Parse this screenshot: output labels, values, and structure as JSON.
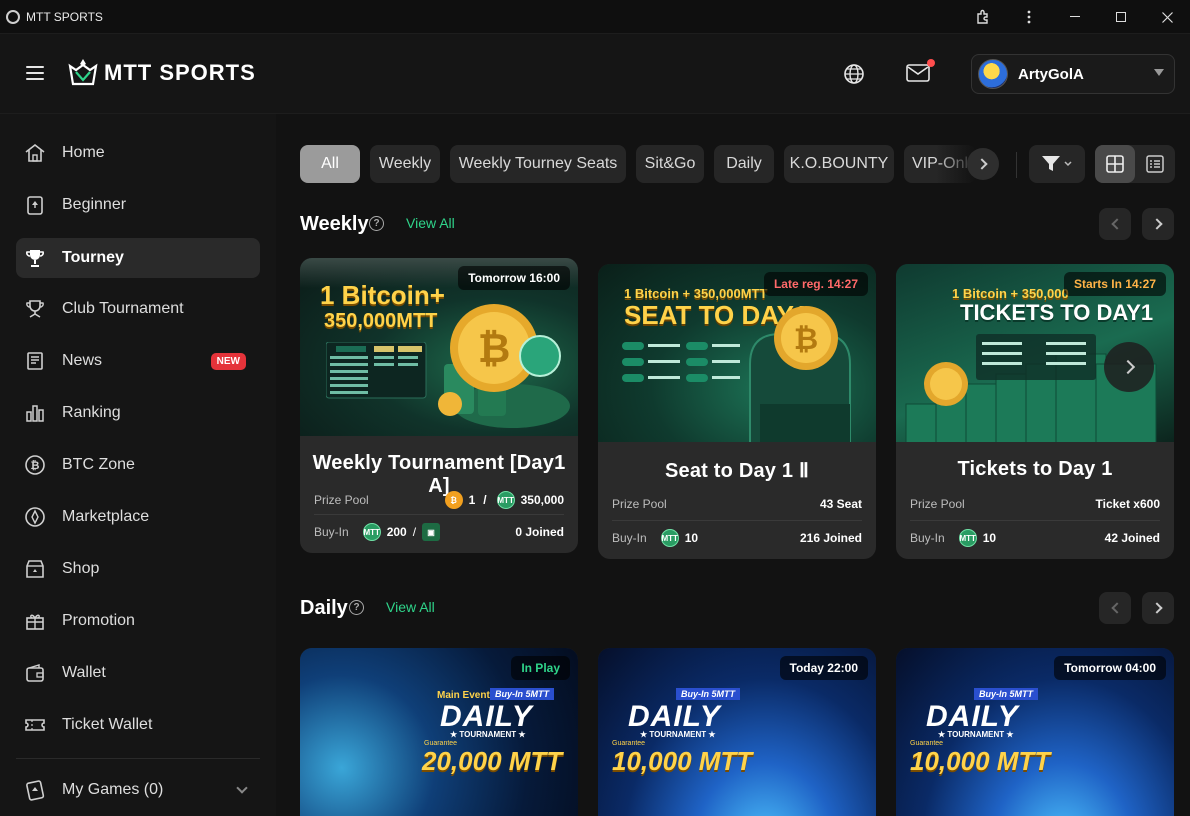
{
  "window": {
    "title": "MTT SPORTS"
  },
  "header": {
    "logo_text": "MTT SPORTS",
    "username": "ArtyGolA"
  },
  "sidebar": {
    "items": [
      {
        "label": "Home",
        "icon": "home-icon"
      },
      {
        "label": "Beginner",
        "icon": "card-icon"
      },
      {
        "label": "Tourney",
        "icon": "trophy-icon",
        "active": true
      },
      {
        "label": "Club Tournament",
        "icon": "club-trophy-icon"
      },
      {
        "label": "News",
        "icon": "news-icon",
        "badge": "NEW"
      },
      {
        "label": "Ranking",
        "icon": "ranking-icon"
      },
      {
        "label": "BTC Zone",
        "icon": "bitcoin-icon"
      },
      {
        "label": "Marketplace",
        "icon": "marketplace-icon"
      },
      {
        "label": "Shop",
        "icon": "shop-icon"
      },
      {
        "label": "Promotion",
        "icon": "gift-icon"
      },
      {
        "label": "Wallet",
        "icon": "wallet-icon"
      },
      {
        "label": "Ticket Wallet",
        "icon": "ticket-icon"
      }
    ],
    "my_games": "My Games (0)"
  },
  "filters": {
    "chips": [
      "All",
      "Weekly",
      "Weekly Tourney Seats",
      "Sit&Go",
      "Daily",
      "K.O.BOUNTY",
      "VIP-Onl"
    ],
    "active": "All"
  },
  "sections": {
    "weekly": {
      "title": "Weekly",
      "view_all": "View All",
      "cards": [
        {
          "status": "Tomorrow 16:00",
          "banner_line1": "1 Bitcoin+",
          "banner_line2": "350,000MTT",
          "title": "Weekly Tournament [Day1 A]",
          "prize_label": "Prize Pool",
          "prize_btc": "1",
          "prize_sep": "/",
          "prize_mtt": "350,000",
          "buyin_label": "Buy-In",
          "buyin_value": "200",
          "buyin_sep": "/",
          "joined": "0 Joined"
        },
        {
          "status": "Late reg. 14:27",
          "banner_line1": "1 Bitcoin + 350,000MTT",
          "banner_line2": "SEAT TO DAY1",
          "title": "Seat to Day 1 Ⅱ",
          "prize_label": "Prize Pool",
          "prize_value": "43 Seat",
          "buyin_label": "Buy-In",
          "buyin_value": "10",
          "joined": "216 Joined"
        },
        {
          "status": "Starts In 14:27",
          "banner_line1": "1 Bitcoin + 350,000",
          "banner_line2": "TICKETS TO DAY1",
          "title": "Tickets to Day 1",
          "prize_label": "Prize Pool",
          "prize_value": "Ticket x600",
          "buyin_label": "Buy-In",
          "buyin_value": "10",
          "joined": "42 Joined"
        }
      ]
    },
    "daily": {
      "title": "Daily",
      "view_all": "View All",
      "cards": [
        {
          "status": "In Play",
          "event": "Main Event",
          "buyin": "Buy-In 5MTT",
          "big": "DAILY",
          "sub": "★ TOURNAMENT ★",
          "guarantee": "Guarantee",
          "amount": "20,000 MTT"
        },
        {
          "status": "Today 22:00",
          "buyin": "Buy-In 5MTT",
          "big": "DAILY",
          "sub": "★ TOURNAMENT ★",
          "guarantee": "Guarantee",
          "amount": "10,000 MTT"
        },
        {
          "status": "Tomorrow 04:00",
          "buyin": "Buy-In 5MTT",
          "big": "DAILY",
          "sub": "★ TOURNAMENT ★",
          "guarantee": "Guarantee",
          "amount": "10,000 MTT"
        }
      ]
    }
  },
  "colors": {
    "accent": "#2fd48a",
    "badge": "#e5333a",
    "late": "#ff6a6a"
  }
}
